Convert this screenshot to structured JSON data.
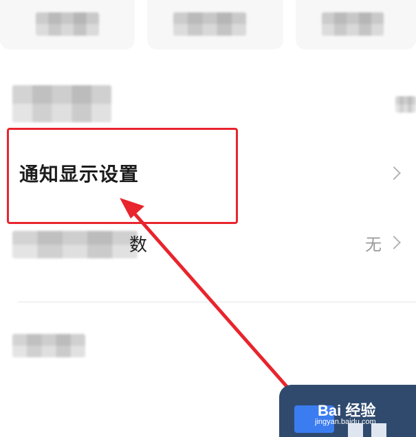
{
  "settings": {
    "notification_display_label": "通知显示设置",
    "row3_partial_char": "数",
    "row3_value": "无"
  },
  "watermark": {
    "brand": "Bai 经验",
    "url": "jingyan.baidu.com"
  },
  "colors": {
    "highlight": "#e8242d",
    "arrow": "#e8242d"
  }
}
